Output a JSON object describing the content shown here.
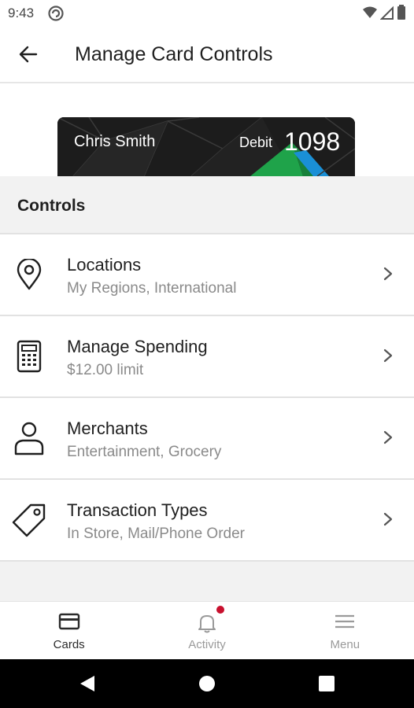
{
  "status_bar": {
    "time": "9:43"
  },
  "app_bar": {
    "title": "Manage Card Controls"
  },
  "card": {
    "holder": "Chris Smith",
    "type": "Debit",
    "last4": "1098"
  },
  "controls": {
    "header": "Controls",
    "items": [
      {
        "label": "Locations",
        "sub": "My Regions, International",
        "icon": "location-pin-icon"
      },
      {
        "label": "Manage Spending",
        "sub": "$12.00 limit",
        "icon": "calculator-icon"
      },
      {
        "label": "Merchants",
        "sub": "Entertainment, Grocery",
        "icon": "person-icon"
      },
      {
        "label": "Transaction Types",
        "sub": "In Store, Mail/Phone Order",
        "icon": "tag-icon"
      }
    ]
  },
  "bottom_nav": {
    "items": [
      {
        "label": "Cards",
        "icon": "card-icon",
        "active": true
      },
      {
        "label": "Activity",
        "icon": "bell-icon",
        "active": false
      },
      {
        "label": "Menu",
        "icon": "hamburger-menu-icon",
        "active": false
      }
    ]
  },
  "colors": {
    "active": "#2b2b2b",
    "inactive": "#9a9a9a",
    "notification": "#c8102e",
    "card_green": "#1fa34a",
    "card_blue": "#1a8fd6"
  }
}
